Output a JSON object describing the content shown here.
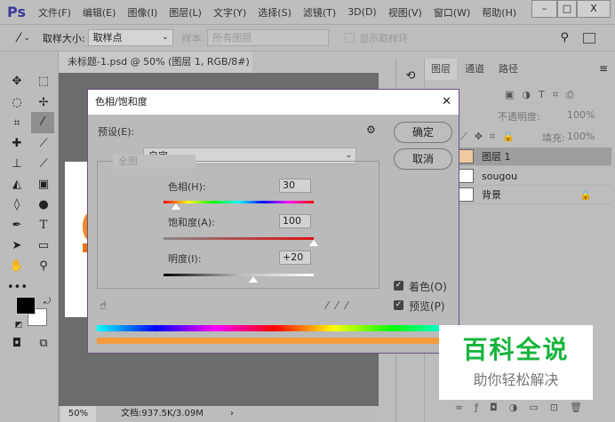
{
  "app": {
    "logo": "Ps",
    "menus": [
      "文件(F)",
      "编辑(E)",
      "图像(I)",
      "图层(L)",
      "文字(Y)",
      "选择(S)",
      "滤镜(T)",
      "3D(D)",
      "视图(V)",
      "窗口(W)",
      "帮助(H)"
    ],
    "win": {
      "min": "–",
      "max": "□",
      "close": "X"
    }
  },
  "options": {
    "sample_size_label": "取样大小:",
    "sample_size_value": "取样点",
    "sample_label": "样本:",
    "sample_value": "所有图层",
    "show_ring": "显示取样环"
  },
  "document": {
    "tab": "未标题-1.psd @ 50% (图层 1, RGB/8#) *",
    "close": "×",
    "zoom": "50%",
    "doc_info": "文档:937.5K/3.09M",
    "arrow": "›"
  },
  "dialog": {
    "title": "色相/饱和度",
    "close": "✕",
    "preset_label": "预设(E):",
    "preset_value": "自定",
    "ok": "确定",
    "cancel": "取消",
    "channel": "全图",
    "hue_label": "色相(H):",
    "hue_value": "30",
    "saturation_label": "饱和度(A):",
    "saturation_value": "100",
    "lightness_label": "明度(I):",
    "lightness_value": "+20",
    "colorize": "着色(O)",
    "preview": "预览(P)",
    "colorize_checked": true,
    "preview_checked": true,
    "hue_pos": 0.08,
    "sat_pos": 1.0,
    "light_pos": 0.6,
    "colorize_color": "#f59a3c"
  },
  "layers": {
    "tabs": [
      "图层",
      "通道",
      "路径"
    ],
    "opacity_label": "不透明度:",
    "opacity": "100%",
    "fill_label": "填充:",
    "fill": "100%",
    "items": [
      {
        "name": "图层 1",
        "selected": true
      },
      {
        "name": "sougou",
        "selected": false
      },
      {
        "name": "背景",
        "selected": false,
        "locked": true
      }
    ]
  },
  "watermark": {
    "title": "百科全说",
    "subtitle": "助你轻松解决"
  }
}
